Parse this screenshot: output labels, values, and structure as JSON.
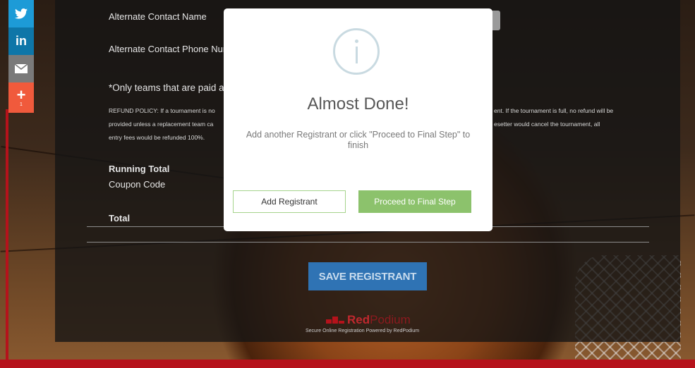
{
  "form": {
    "alt_contact_name_label": "Alternate Contact Name",
    "alt_contact_phone_label": "Alternate Contact Phone Nur",
    "paid_note": "*Only teams that are paid anc",
    "refund_line1_left": "REFUND POLICY: If a tournament is no",
    "refund_line1_right": "ent. If the tournament is full, no refund will be",
    "refund_line2_left": "provided unless a replacement team ca",
    "refund_line2_right": "esetter would cancel the tournament, all",
    "refund_line3": "entry fees would be refunded 100%.",
    "running_total_label": "Running Total",
    "coupon_code_label": "Coupon Code",
    "total_label": "Total",
    "save_button": "SAVE REGISTRANT"
  },
  "footer": {
    "brand_part1": "Red",
    "brand_part2": "Podium",
    "tagline": "Secure Online Registration Powered by RedPodium"
  },
  "social": {
    "twitter_icon": "twitter-icon",
    "linkedin_label": "in",
    "email_icon": "email-icon",
    "more_label": "+",
    "more_count": "1"
  },
  "modal": {
    "icon": "info-icon",
    "title": "Almost Done!",
    "message": "Add another Registrant or click \"Proceed to Final Step\" to finish",
    "add_button": "Add Registrant",
    "proceed_button": "Proceed to Final Step"
  },
  "colors": {
    "proceed_green": "#8cc26c",
    "save_blue": "#2f73b4",
    "brand_red": "#b5121b"
  }
}
